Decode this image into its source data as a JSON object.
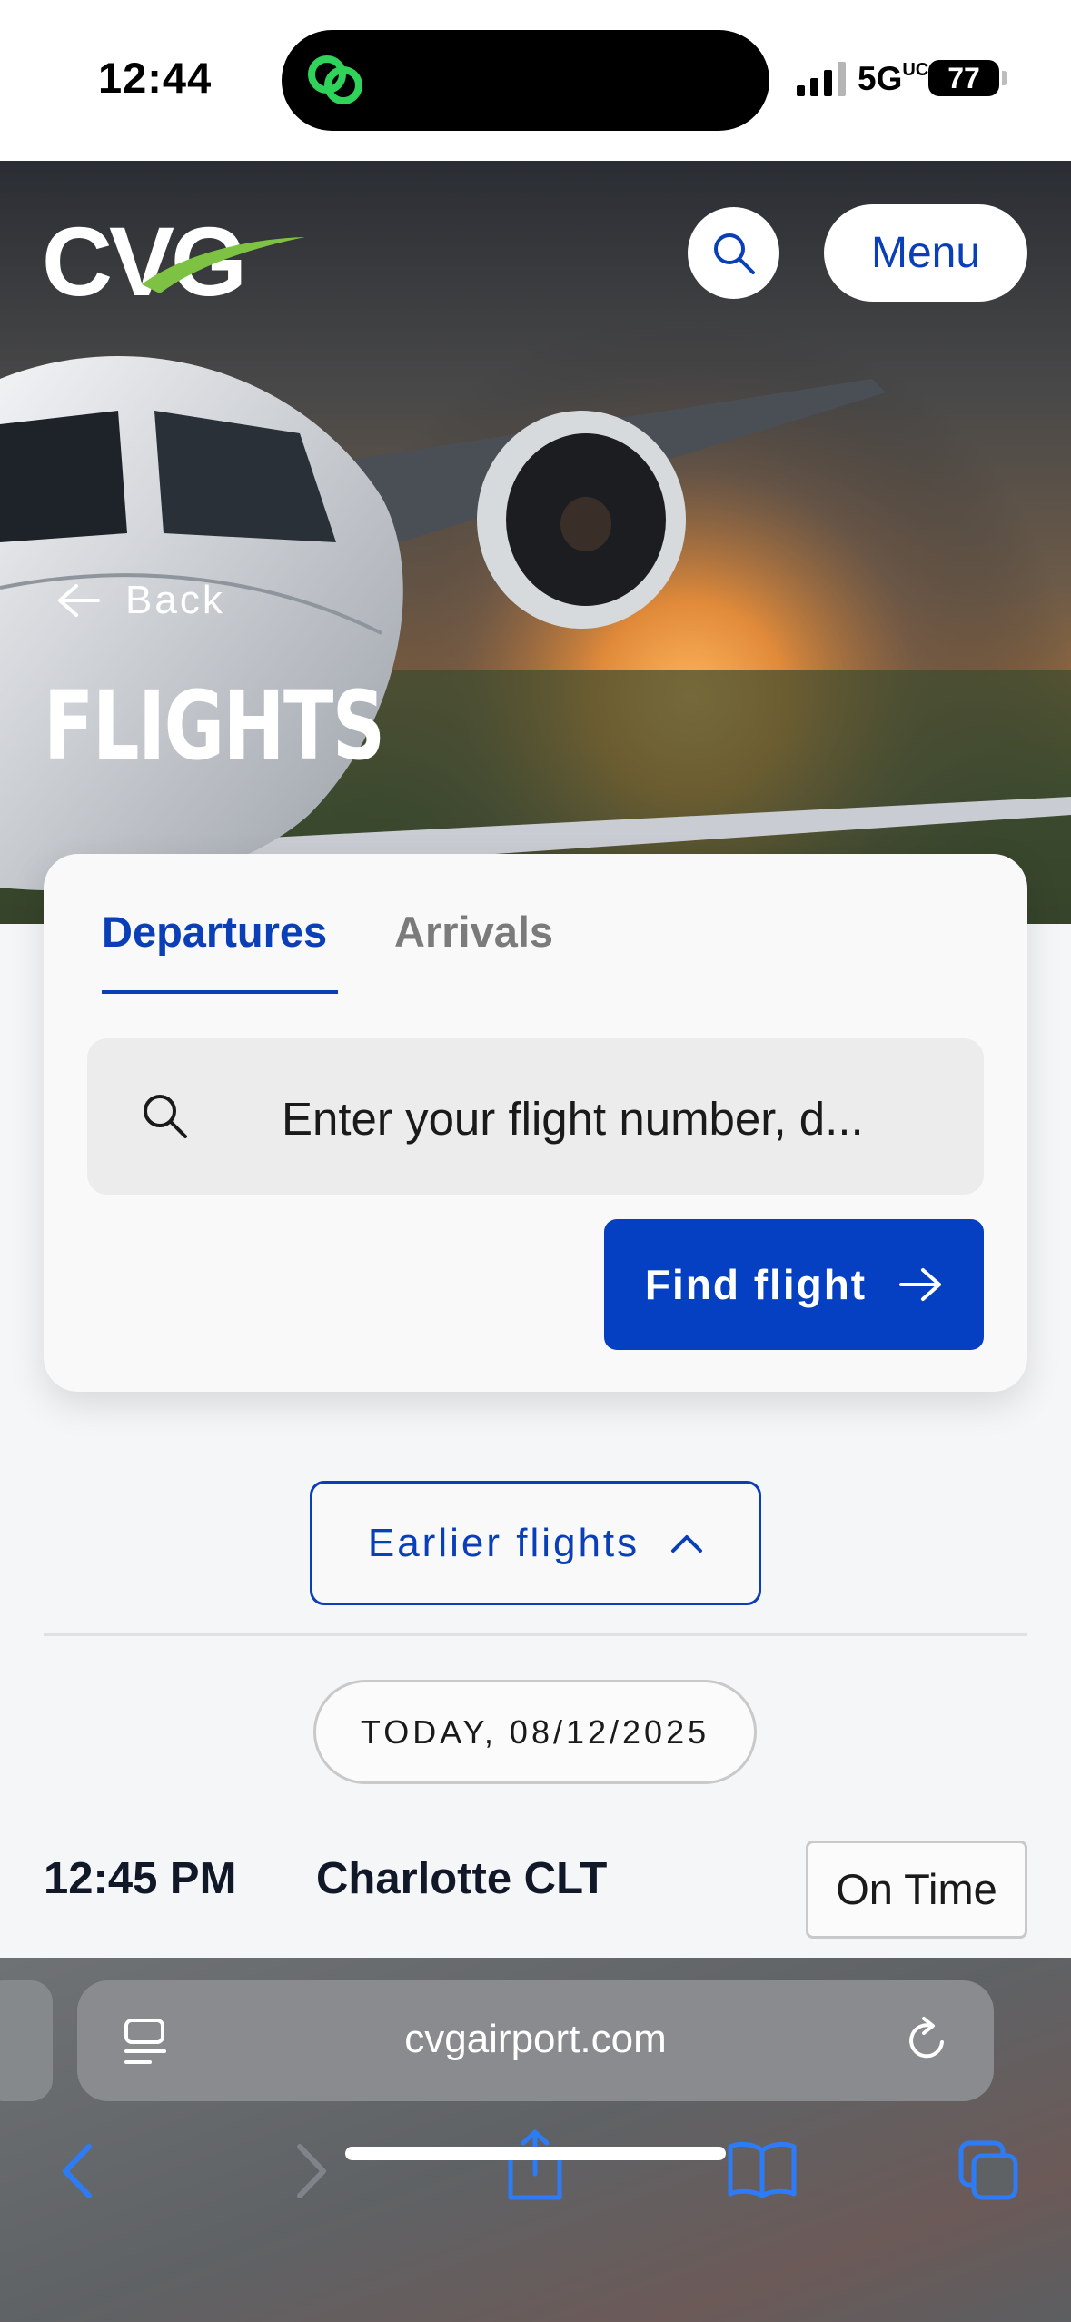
{
  "status_bar": {
    "time": "12:44",
    "network": "5G",
    "network_sub": "UC",
    "battery": "77"
  },
  "header": {
    "logo_text": "CVG",
    "menu_label": "Menu"
  },
  "hero": {
    "back_label": "Back",
    "title": "FLIGHTS"
  },
  "search_card": {
    "tabs": [
      {
        "label": "Departures",
        "active": true
      },
      {
        "label": "Arrivals",
        "active": false
      }
    ],
    "search_placeholder": "Enter your flight number, d...",
    "find_button_label": "Find flight"
  },
  "flights": {
    "earlier_label": "Earlier flights",
    "date_label": "TODAY, 08/12/2025",
    "rows": [
      {
        "time": "12:45 PM",
        "destination": "Charlotte CLT",
        "status": "On Time"
      }
    ]
  },
  "browser": {
    "url": "cvgairport.com"
  },
  "colors": {
    "brand_blue": "#0a3fb8",
    "button_blue": "#0640c2",
    "logo_accent_green": "#7dc242",
    "app_icon_green": "#2fd35a"
  }
}
